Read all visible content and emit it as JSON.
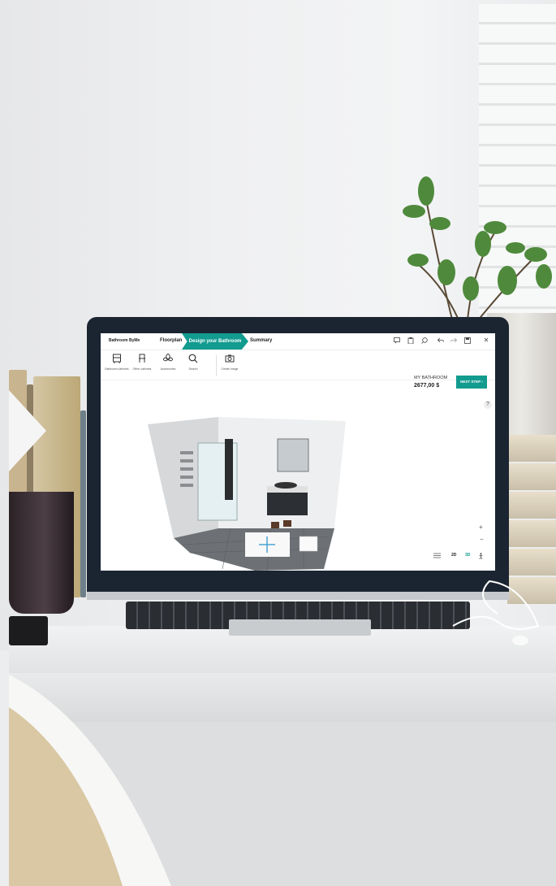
{
  "app": {
    "brand": "Bathroom ByMe",
    "steps": [
      "Floorplan",
      "Design your Bathroom",
      "Summary"
    ],
    "active_step": "Design your Bathroom",
    "top_icons": [
      "comment-icon",
      "clipboard-icon",
      "search-zoom-icon",
      "undo-icon",
      "redo-icon",
      "save-icon",
      "close-icon"
    ],
    "close_glyph": "✕",
    "tools": [
      {
        "label": "Bathroom cabinets",
        "icon": "cabinet-icon"
      },
      {
        "label": "Other cabinets",
        "icon": "chair-icon"
      },
      {
        "label": "Accessories",
        "icon": "plant-icon"
      },
      {
        "label": "Search",
        "icon": "search-icon"
      },
      {
        "label": "Create image",
        "icon": "camera-icon"
      }
    ],
    "total_label": "MY BATHROOM",
    "total_price": "2677,00",
    "currency": "$",
    "next_button": "NEXT STEP ›",
    "help_glyph": "?",
    "zoom_in": "+",
    "zoom_out": "−",
    "view_modes": [
      "2D",
      "3D"
    ],
    "active_view": "3D",
    "accent_color": "#129b8f"
  }
}
